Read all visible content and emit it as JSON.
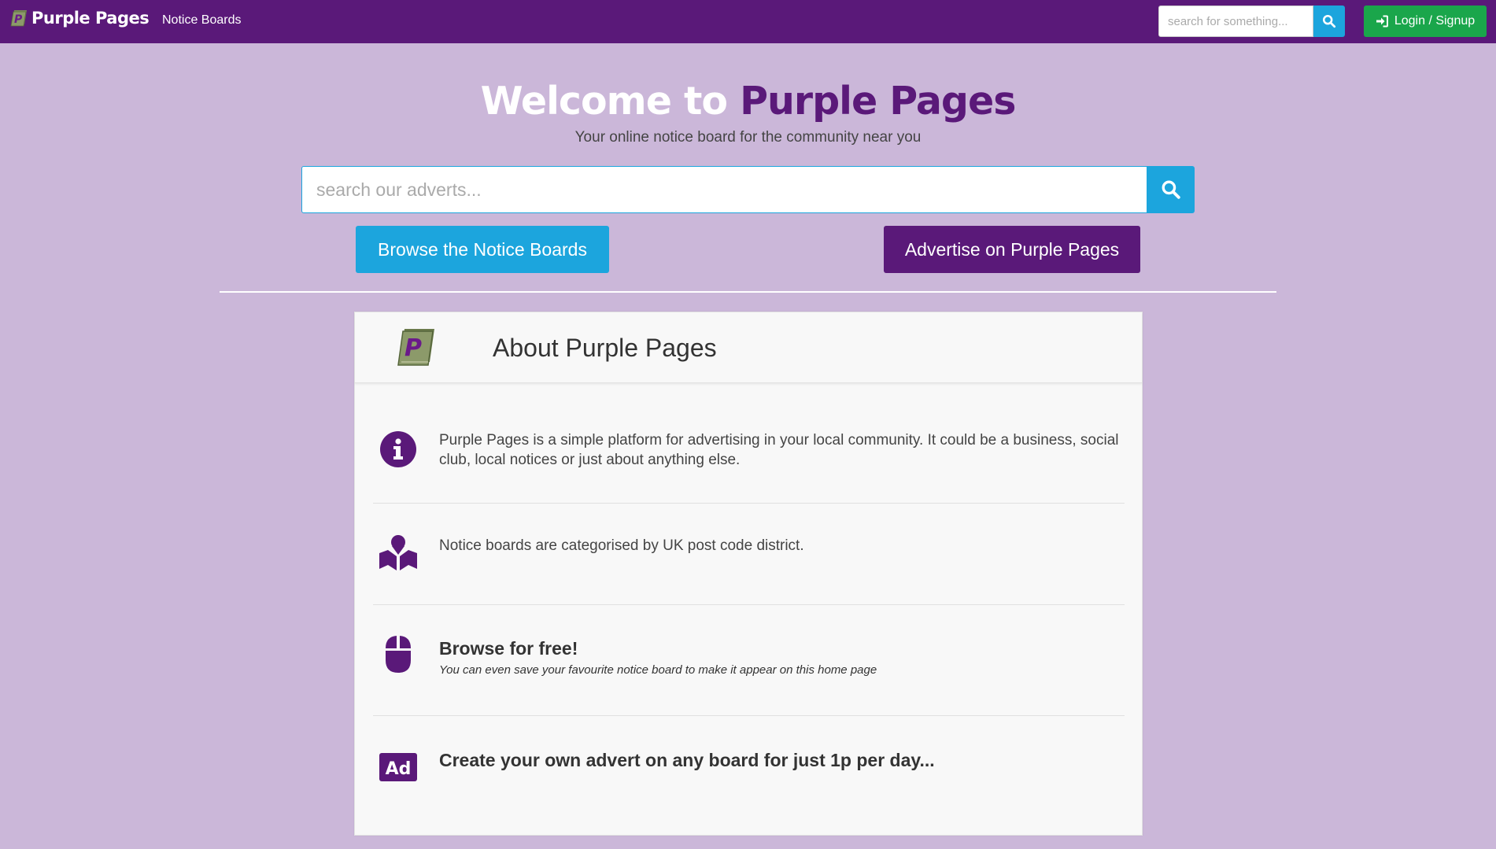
{
  "navbar": {
    "brand": "Purple Pages",
    "link_notice_boards": "Notice Boards",
    "search_placeholder": "search for something...",
    "login_label": "Login / Signup"
  },
  "hero": {
    "title_prefix": "Welcome to",
    "title_brand": "Purple Pages",
    "subtitle": "Your online notice board for the community near you",
    "search_placeholder": "search our adverts...",
    "browse_button": "Browse the Notice Boards",
    "advertise_button": "Advertise on Purple Pages"
  },
  "about": {
    "title": "About Purple Pages",
    "items": [
      {
        "icon": "info-icon",
        "text": "Purple Pages is a simple platform for advertising in your local community. It could be a business, social club, local notices or just about anything else."
      },
      {
        "icon": "map-icon",
        "text": "Notice boards are categorised by UK post code district."
      },
      {
        "icon": "mouse-icon",
        "heading": "Browse for free!",
        "note": "You can even save your favourite notice board to make it appear on this home page"
      },
      {
        "icon": "ad-icon",
        "icon_text": "Ad",
        "heading": "Create your own advert on any board for just 1p per day..."
      }
    ]
  },
  "colors": {
    "primary_purple": "#5a1979",
    "page_background": "#cbb7d9",
    "info_blue": "#1ca5dd",
    "success_green": "#1aa64b"
  }
}
